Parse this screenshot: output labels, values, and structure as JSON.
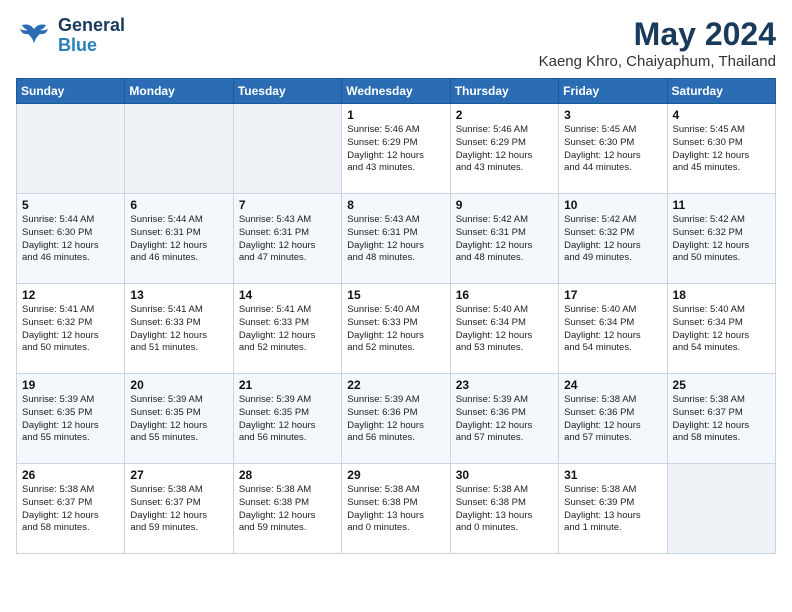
{
  "header": {
    "logo_line1": "General",
    "logo_line2": "Blue",
    "month_year": "May 2024",
    "location": "Kaeng Khro, Chaiyaphum, Thailand"
  },
  "weekdays": [
    "Sunday",
    "Monday",
    "Tuesday",
    "Wednesday",
    "Thursday",
    "Friday",
    "Saturday"
  ],
  "weeks": [
    [
      {
        "day": "",
        "info": ""
      },
      {
        "day": "",
        "info": ""
      },
      {
        "day": "",
        "info": ""
      },
      {
        "day": "1",
        "info": "Sunrise: 5:46 AM\nSunset: 6:29 PM\nDaylight: 12 hours\nand 43 minutes."
      },
      {
        "day": "2",
        "info": "Sunrise: 5:46 AM\nSunset: 6:29 PM\nDaylight: 12 hours\nand 43 minutes."
      },
      {
        "day": "3",
        "info": "Sunrise: 5:45 AM\nSunset: 6:30 PM\nDaylight: 12 hours\nand 44 minutes."
      },
      {
        "day": "4",
        "info": "Sunrise: 5:45 AM\nSunset: 6:30 PM\nDaylight: 12 hours\nand 45 minutes."
      }
    ],
    [
      {
        "day": "5",
        "info": "Sunrise: 5:44 AM\nSunset: 6:30 PM\nDaylight: 12 hours\nand 46 minutes."
      },
      {
        "day": "6",
        "info": "Sunrise: 5:44 AM\nSunset: 6:31 PM\nDaylight: 12 hours\nand 46 minutes."
      },
      {
        "day": "7",
        "info": "Sunrise: 5:43 AM\nSunset: 6:31 PM\nDaylight: 12 hours\nand 47 minutes."
      },
      {
        "day": "8",
        "info": "Sunrise: 5:43 AM\nSunset: 6:31 PM\nDaylight: 12 hours\nand 48 minutes."
      },
      {
        "day": "9",
        "info": "Sunrise: 5:42 AM\nSunset: 6:31 PM\nDaylight: 12 hours\nand 48 minutes."
      },
      {
        "day": "10",
        "info": "Sunrise: 5:42 AM\nSunset: 6:32 PM\nDaylight: 12 hours\nand 49 minutes."
      },
      {
        "day": "11",
        "info": "Sunrise: 5:42 AM\nSunset: 6:32 PM\nDaylight: 12 hours\nand 50 minutes."
      }
    ],
    [
      {
        "day": "12",
        "info": "Sunrise: 5:41 AM\nSunset: 6:32 PM\nDaylight: 12 hours\nand 50 minutes."
      },
      {
        "day": "13",
        "info": "Sunrise: 5:41 AM\nSunset: 6:33 PM\nDaylight: 12 hours\nand 51 minutes."
      },
      {
        "day": "14",
        "info": "Sunrise: 5:41 AM\nSunset: 6:33 PM\nDaylight: 12 hours\nand 52 minutes."
      },
      {
        "day": "15",
        "info": "Sunrise: 5:40 AM\nSunset: 6:33 PM\nDaylight: 12 hours\nand 52 minutes."
      },
      {
        "day": "16",
        "info": "Sunrise: 5:40 AM\nSunset: 6:34 PM\nDaylight: 12 hours\nand 53 minutes."
      },
      {
        "day": "17",
        "info": "Sunrise: 5:40 AM\nSunset: 6:34 PM\nDaylight: 12 hours\nand 54 minutes."
      },
      {
        "day": "18",
        "info": "Sunrise: 5:40 AM\nSunset: 6:34 PM\nDaylight: 12 hours\nand 54 minutes."
      }
    ],
    [
      {
        "day": "19",
        "info": "Sunrise: 5:39 AM\nSunset: 6:35 PM\nDaylight: 12 hours\nand 55 minutes."
      },
      {
        "day": "20",
        "info": "Sunrise: 5:39 AM\nSunset: 6:35 PM\nDaylight: 12 hours\nand 55 minutes."
      },
      {
        "day": "21",
        "info": "Sunrise: 5:39 AM\nSunset: 6:35 PM\nDaylight: 12 hours\nand 56 minutes."
      },
      {
        "day": "22",
        "info": "Sunrise: 5:39 AM\nSunset: 6:36 PM\nDaylight: 12 hours\nand 56 minutes."
      },
      {
        "day": "23",
        "info": "Sunrise: 5:39 AM\nSunset: 6:36 PM\nDaylight: 12 hours\nand 57 minutes."
      },
      {
        "day": "24",
        "info": "Sunrise: 5:38 AM\nSunset: 6:36 PM\nDaylight: 12 hours\nand 57 minutes."
      },
      {
        "day": "25",
        "info": "Sunrise: 5:38 AM\nSunset: 6:37 PM\nDaylight: 12 hours\nand 58 minutes."
      }
    ],
    [
      {
        "day": "26",
        "info": "Sunrise: 5:38 AM\nSunset: 6:37 PM\nDaylight: 12 hours\nand 58 minutes."
      },
      {
        "day": "27",
        "info": "Sunrise: 5:38 AM\nSunset: 6:37 PM\nDaylight: 12 hours\nand 59 minutes."
      },
      {
        "day": "28",
        "info": "Sunrise: 5:38 AM\nSunset: 6:38 PM\nDaylight: 12 hours\nand 59 minutes."
      },
      {
        "day": "29",
        "info": "Sunrise: 5:38 AM\nSunset: 6:38 PM\nDaylight: 13 hours\nand 0 minutes."
      },
      {
        "day": "30",
        "info": "Sunrise: 5:38 AM\nSunset: 6:38 PM\nDaylight: 13 hours\nand 0 minutes."
      },
      {
        "day": "31",
        "info": "Sunrise: 5:38 AM\nSunset: 6:39 PM\nDaylight: 13 hours\nand 1 minute."
      },
      {
        "day": "",
        "info": ""
      }
    ]
  ]
}
